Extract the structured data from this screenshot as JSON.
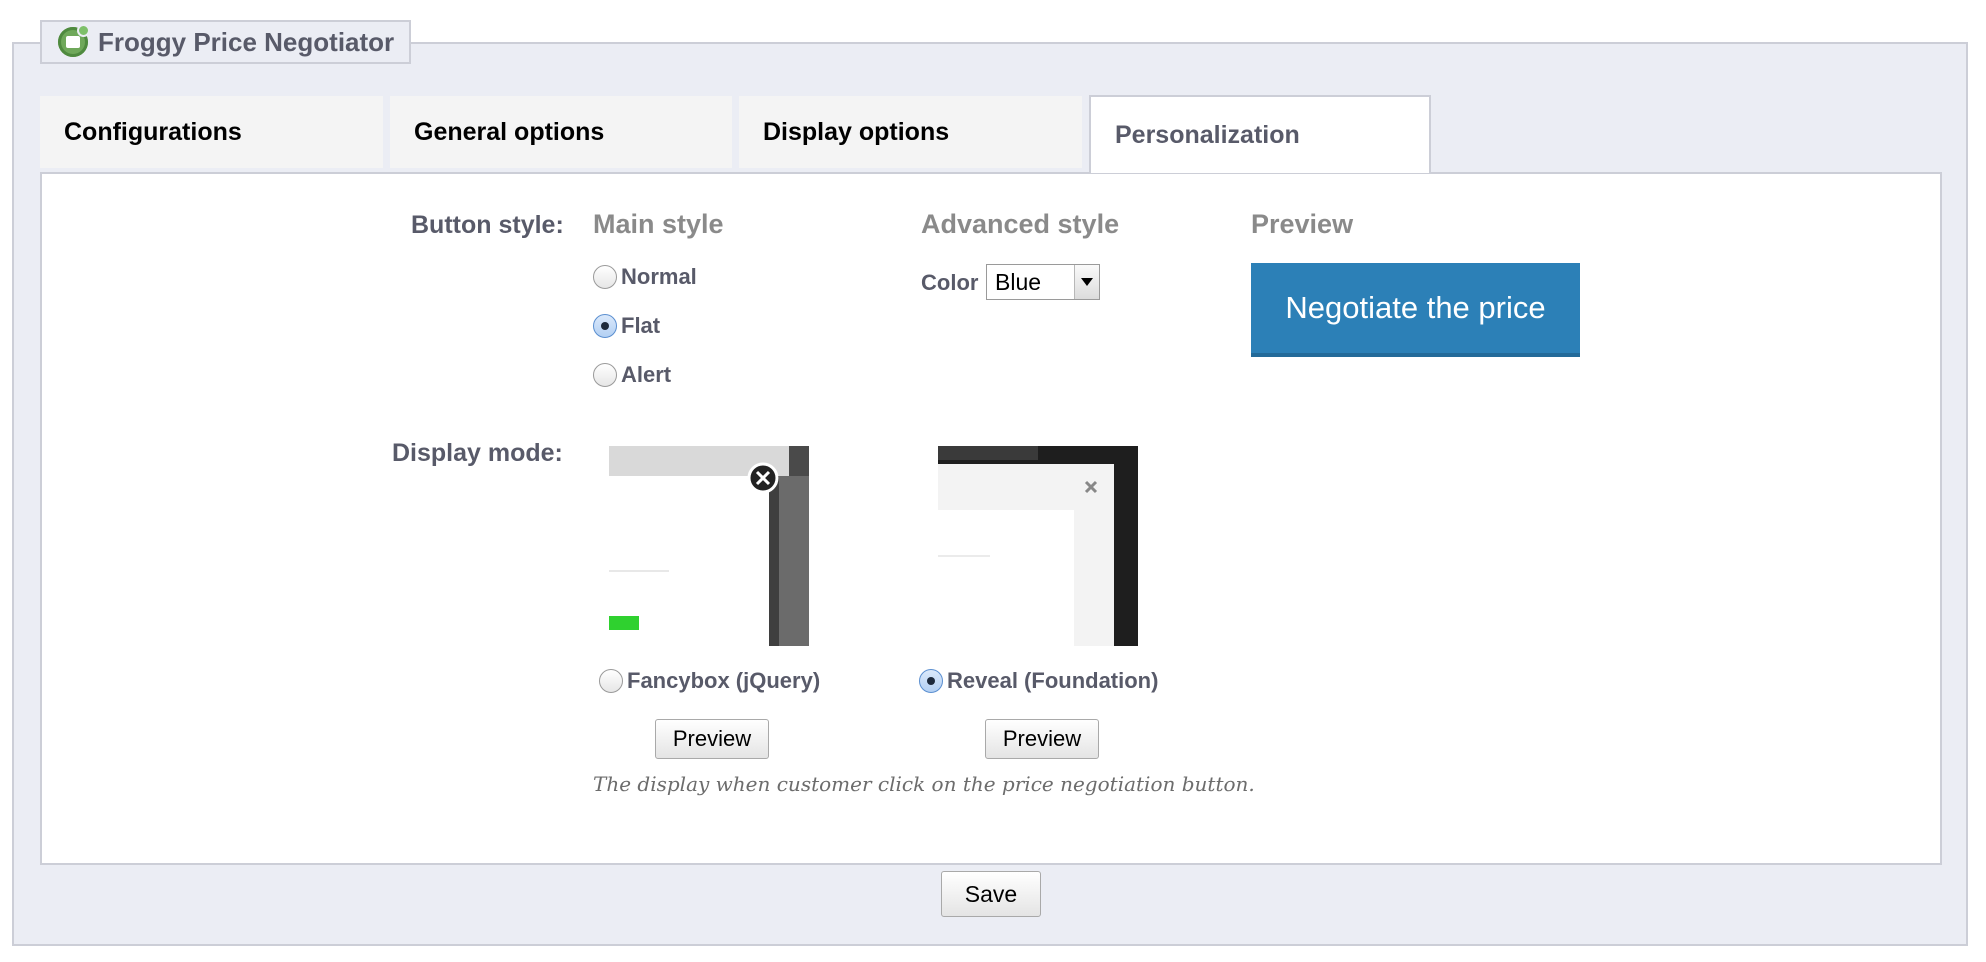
{
  "module": {
    "title": "Froggy Price Negotiator",
    "logo_icon": "froggy-logo-icon"
  },
  "tabs": [
    {
      "label": "Configurations",
      "active": false
    },
    {
      "label": "General options",
      "active": false
    },
    {
      "label": "Display options",
      "active": false
    },
    {
      "label": "Personalization",
      "active": true
    }
  ],
  "button_style": {
    "label": "Button style:",
    "main_style": {
      "title": "Main style",
      "options": [
        {
          "label": "Normal",
          "checked": false
        },
        {
          "label": "Flat",
          "checked": true
        },
        {
          "label": "Alert",
          "checked": false
        }
      ]
    },
    "advanced_style": {
      "title": "Advanced style",
      "color_label": "Color",
      "color_value": "Blue"
    },
    "preview": {
      "title": "Preview",
      "button_label": "Negotiate the price",
      "button_color": "#2c80b7"
    }
  },
  "display_mode": {
    "label": "Display mode:",
    "options": [
      {
        "label": "Fancybox (jQuery)",
        "checked": false,
        "preview_label": "Preview"
      },
      {
        "label": "Reveal (Foundation)",
        "checked": true,
        "preview_label": "Preview"
      }
    ],
    "hint": "The display when customer click on the price negotiation button."
  },
  "save_label": "Save"
}
